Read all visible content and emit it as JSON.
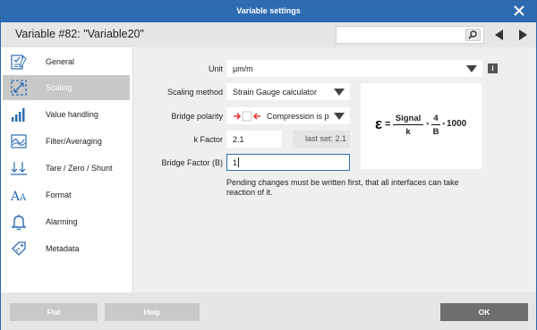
{
  "window": {
    "title": "Variable settings",
    "variable_title": "Variable #82: \"Variable20\"",
    "search_value": ""
  },
  "sidebar": {
    "items": [
      {
        "label": "General",
        "icon": "general-icon"
      },
      {
        "label": "Scaling",
        "icon": "scaling-icon",
        "active": true
      },
      {
        "label": "Value handling",
        "icon": "value-handling-icon"
      },
      {
        "label": "Filter/Averaging",
        "icon": "filter-icon"
      },
      {
        "label": "Tare / Zero / Shunt",
        "icon": "tare-icon"
      },
      {
        "label": "Format",
        "icon": "format-icon"
      },
      {
        "label": "Alarming",
        "icon": "bell-icon"
      },
      {
        "label": "Metadata",
        "icon": "metadata-icon"
      }
    ]
  },
  "form": {
    "unit_label": "Unit",
    "unit_value": "µm/m",
    "info_icon": "i",
    "scaling_method_label": "Scaling method",
    "scaling_method_value": "Strain Gauge calculator",
    "bridge_polarity_label": "Bridge polarity",
    "bridge_polarity_value": "Compression is p",
    "k_factor_label": "k Factor",
    "k_factor_value": "2.1",
    "last_set": "last set: 2.1",
    "bridge_factor_label": "Bridge Factor (B)",
    "bridge_factor_value": "1",
    "note": "Pending changes must be written first, that all interfaces can take reaction of it."
  },
  "formula": {
    "lhs": "ε",
    "eq": "=",
    "num1": "Signal",
    "den1": "k",
    "times1": "*",
    "num2": "4",
    "den2": "B",
    "times2": "*",
    "const": "1000"
  },
  "footer": {
    "flat_label": "Flat",
    "help_label": "Help",
    "ok_label": "OK"
  },
  "colors": {
    "title_bar": "#2d6bb3",
    "accent_blue": "#2e6db4",
    "selected_item": "#c8c8c8",
    "ok_button": "#6e6e6e",
    "polarity_arrow": "#e23b3b"
  }
}
